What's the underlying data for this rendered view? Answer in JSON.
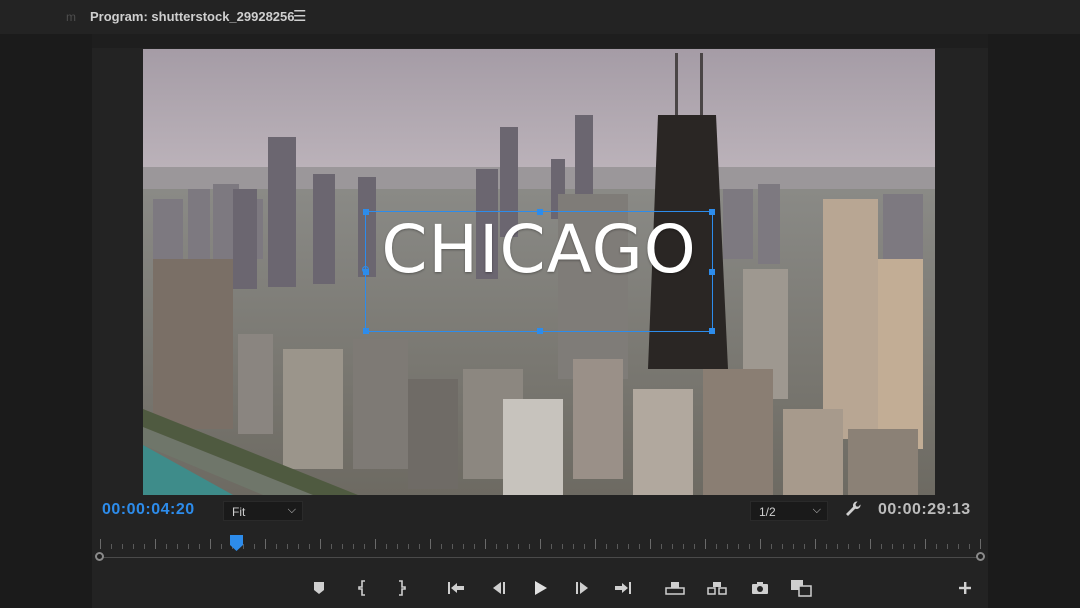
{
  "panel": {
    "ghost_tab": "m",
    "title": "Program: shutterstock_29928256",
    "menu_icon": "hamburger-icon"
  },
  "overlay": {
    "title_text": "CHICAGO"
  },
  "timecode": {
    "current": "00:00:04:20",
    "duration": "00:00:29:13"
  },
  "controls": {
    "zoom": {
      "value": "Fit"
    },
    "resolution": {
      "value": "1/2"
    },
    "settings_icon": "wrench-icon",
    "playhead_fraction": 0.155
  },
  "transport_icons": [
    "add-marker-icon",
    "mark-in-icon",
    "mark-out-icon",
    "go-to-in-icon",
    "step-back-icon",
    "play-icon",
    "step-forward-icon",
    "go-to-out-icon",
    "lift-icon",
    "extract-icon",
    "export-frame-icon",
    "comparison-view-icon",
    "button-editor-icon"
  ],
  "colors": {
    "accent": "#2d8ceb",
    "panel_bg": "#232323"
  }
}
